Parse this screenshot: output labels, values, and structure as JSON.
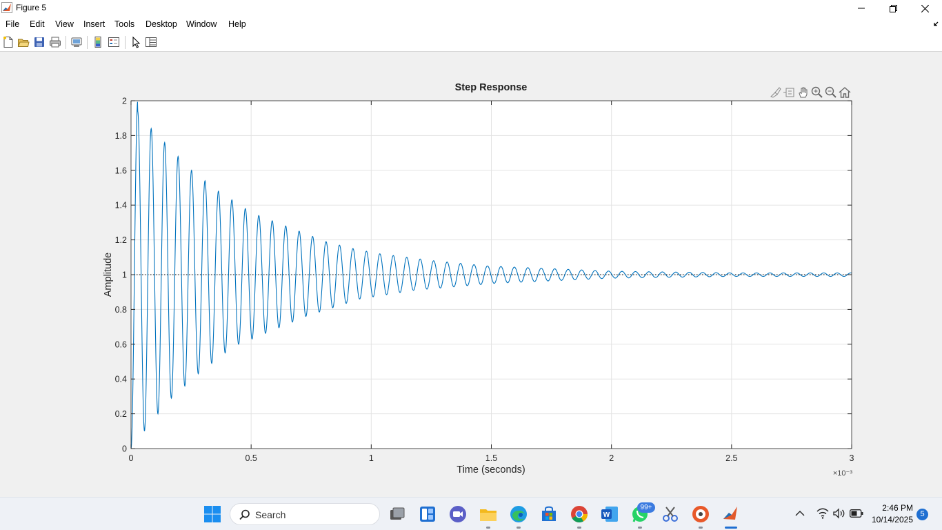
{
  "window": {
    "title": "Figure 5",
    "icon": "matlab-icon",
    "controls": [
      "minimize-icon",
      "maximize-icon",
      "close-icon"
    ]
  },
  "menubar": {
    "items": [
      "File",
      "Edit",
      "View",
      "Insert",
      "Tools",
      "Desktop",
      "Window",
      "Help"
    ]
  },
  "toolbar": {
    "icons": [
      "new-figure-icon",
      "open-file-icon",
      "save-icon",
      "print-icon",
      "link-plot-icon",
      "colorbar-icon",
      "legend-icon",
      "edit-plot-icon",
      "property-inspector-icon"
    ]
  },
  "axes_toolbar": {
    "icons": [
      "brush-icon",
      "datatip-icon",
      "pan-icon",
      "zoom-in-icon",
      "zoom-out-icon",
      "home-icon"
    ]
  },
  "chart_data": {
    "type": "line",
    "title": "Step Response",
    "xlabel": "Time (seconds)",
    "ylabel": "Amplitude",
    "x_exponent_label": "×10⁻³",
    "xlim": [
      0,
      0.003
    ],
    "ylim": [
      0,
      2
    ],
    "xticks": [
      0,
      0.0005,
      0.001,
      0.0015,
      0.002,
      0.0025,
      0.003
    ],
    "xtick_labels": [
      "0",
      "0.5",
      "1",
      "1.5",
      "2",
      "2.5",
      "3"
    ],
    "yticks": [
      0,
      0.2,
      0.4,
      0.6,
      0.8,
      1,
      1.2,
      1.4,
      1.6,
      1.8,
      2
    ],
    "ytick_labels": [
      "0",
      "0.2",
      "0.4",
      "0.6",
      "0.8",
      "1",
      "1.2",
      "1.4",
      "1.6",
      "1.8",
      "2"
    ],
    "grid": true,
    "series_color": "#0072bd",
    "reference_line": {
      "y": 1,
      "style": "dotted",
      "color": "#000000"
    },
    "peaks": [
      {
        "x": 2.8e-05,
        "y": 1.94
      },
      {
        "x": 8.4e-05,
        "y": 1.84
      },
      {
        "x": 0.00014,
        "y": 1.76
      },
      {
        "x": 0.000196,
        "y": 1.68
      },
      {
        "x": 0.000252,
        "y": 1.6
      },
      {
        "x": 0.000308,
        "y": 1.54
      },
      {
        "x": 0.000364,
        "y": 1.48
      },
      {
        "x": 0.00042,
        "y": 1.43
      },
      {
        "x": 0.000476,
        "y": 1.38
      },
      {
        "x": 0.000532,
        "y": 1.34
      },
      {
        "x": 0.000588,
        "y": 1.31
      },
      {
        "x": 0.0007,
        "y": 1.25
      },
      {
        "x": 0.000812,
        "y": 1.19
      },
      {
        "x": 0.000924,
        "y": 1.15
      },
      {
        "x": 0.001036,
        "y": 1.12
      },
      {
        "x": 0.00126,
        "y": 1.08
      },
      {
        "x": 0.001484,
        "y": 1.05
      },
      {
        "x": 0.002,
        "y": 1.02
      },
      {
        "x": 0.0025,
        "y": 1.01
      }
    ],
    "troughs": [
      {
        "x": 5.6e-05,
        "y": 0.1
      },
      {
        "x": 0.000112,
        "y": 0.2
      },
      {
        "x": 0.000168,
        "y": 0.29
      },
      {
        "x": 0.000224,
        "y": 0.36
      },
      {
        "x": 0.00028,
        "y": 0.43
      },
      {
        "x": 0.000336,
        "y": 0.49
      },
      {
        "x": 0.000392,
        "y": 0.55
      },
      {
        "x": 0.000448,
        "y": 0.6
      },
      {
        "x": 0.000504,
        "y": 0.63
      },
      {
        "x": 0.000728,
        "y": 0.76
      },
      {
        "x": 0.000952,
        "y": 0.86
      },
      {
        "x": 0.001176,
        "y": 0.91
      },
      {
        "x": 0.001512,
        "y": 0.95
      },
      {
        "x": 0.002,
        "y": 0.98
      },
      {
        "x": 0.0025,
        "y": 0.99
      }
    ],
    "final_value": 1.0
  },
  "taskbar": {
    "search_label": "Search",
    "apps": [
      "windows-start-icon",
      "search-icon",
      "task-view-icon",
      "widgets-icon",
      "teams-meet-icon",
      "file-explorer-icon",
      "edge-icon",
      "microsoft-store-icon",
      "chrome-icon",
      "word-icon",
      "whatsapp-icon",
      "snipping-tool-icon",
      "media-player-icon",
      "matlab-icon"
    ],
    "whatsapp_badge": "99+",
    "time": "2:46 PM",
    "date": "10/14/2025",
    "notification_count": "5",
    "tray_icons": [
      "chevron-up-icon",
      "wifi-icon",
      "volume-icon",
      "battery-icon"
    ]
  }
}
